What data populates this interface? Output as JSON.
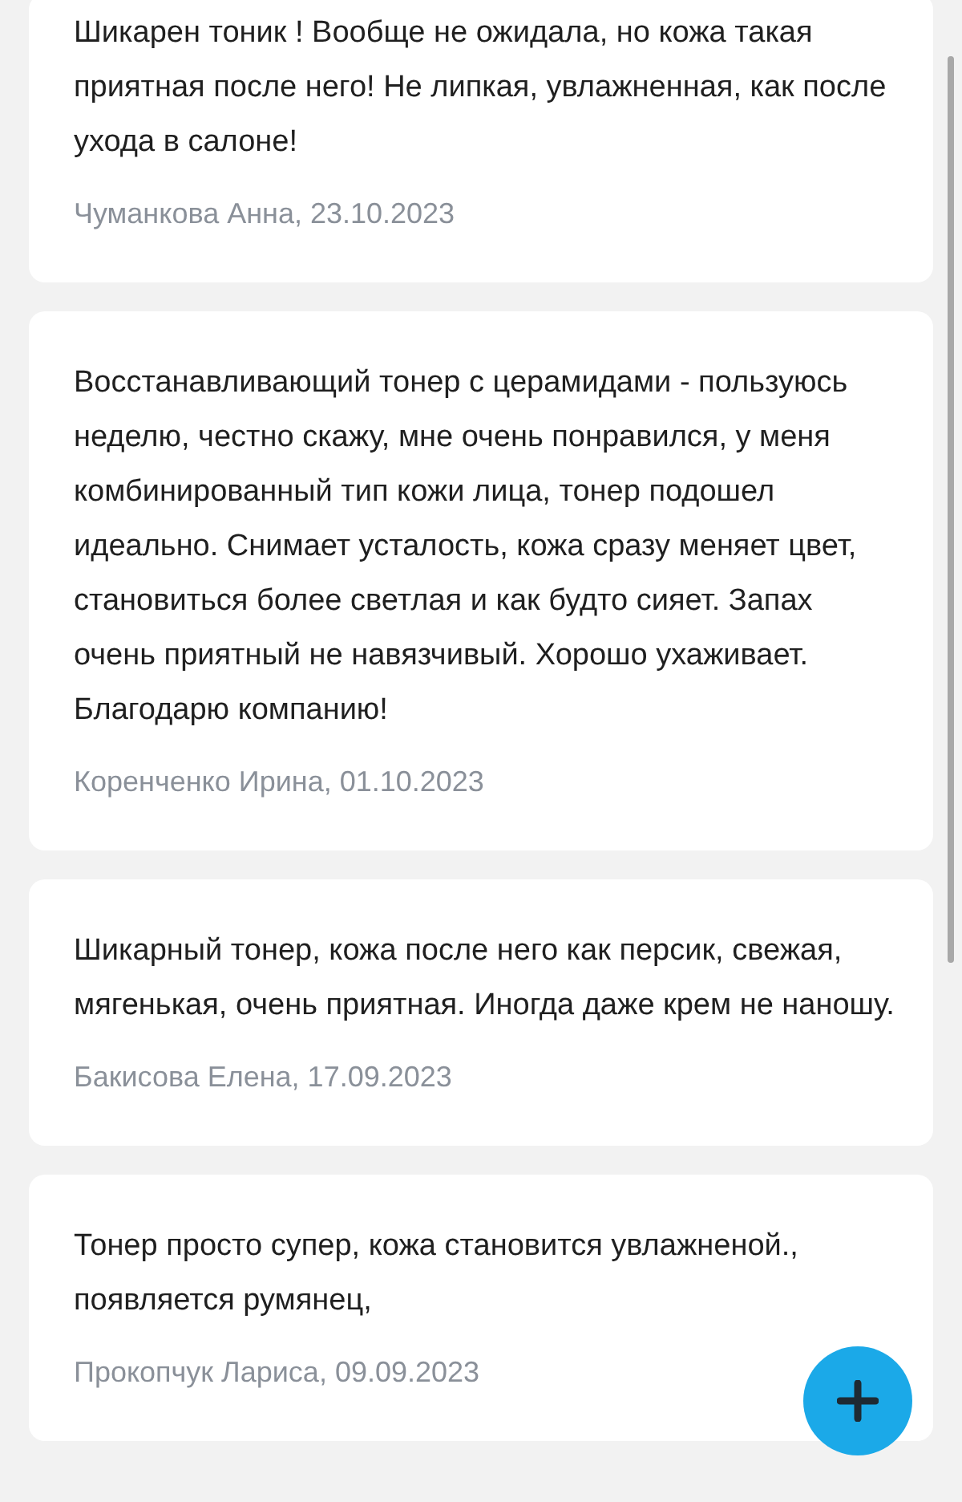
{
  "reviews": [
    {
      "text": "Шикарен тоник ! Вообще не ожидала, но кожа такая приятная после него! Не липкая, увлажненная, как после ухода в салоне!",
      "author": "Чуманкова Анна, 23.10.2023"
    },
    {
      "text": "Восстанавливающий тонер с церамидами - пользуюсь неделю, честно скажу, мне очень понравился, у меня комбинированный тип кожи лица, тонер подошел идеально. Снимает усталость, кожа сразу меняет цвет, становиться более светлая и как будто сияет. Запах очень приятный не навязчивый. Хорошо ухаживает. Благодарю компанию!",
      "author": "Коренченко Ирина, 01.10.2023"
    },
    {
      "text": "Шикарный тонер, кожа после него как персик, свежая, мягенькая, очень приятная. Иногда даже крем не наношу.",
      "author": "Бакисова Елена, 17.09.2023"
    },
    {
      "text": "Тонер просто супер, кожа становится увлажненой., появляется румянец,",
      "author": "Прокопчук Лариса, 09.09.2023"
    }
  ]
}
